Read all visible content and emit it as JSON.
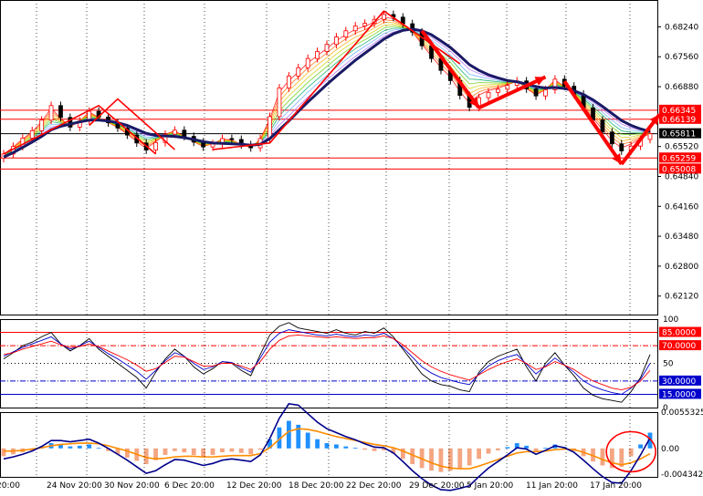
{
  "chart_data": [
    {
      "type": "line",
      "panel": "price",
      "y_ticks": [
        "0.68240",
        "0.67560",
        "0.66880",
        "0.65520",
        "0.64840",
        "0.64160",
        "0.63480",
        "0.62800",
        "0.62120"
      ],
      "ylim": [
        0.617,
        0.6885
      ],
      "level_badges": [
        {
          "label": "0.66345",
          "value": 0.66345,
          "color": "#ff0000"
        },
        {
          "label": "0.66139",
          "value": 0.66139,
          "color": "#ff0000"
        },
        {
          "label": "0.65811",
          "value": 0.65811,
          "color": "#000000"
        },
        {
          "label": "0.65259",
          "value": 0.65259,
          "color": "#ff0000"
        },
        {
          "label": "0.65008",
          "value": 0.65008,
          "color": "#ff0000"
        }
      ],
      "close_series": [
        0.6535,
        0.6552,
        0.6571,
        0.6588,
        0.6612,
        0.6645,
        0.6618,
        0.6596,
        0.661,
        0.6632,
        0.6619,
        0.6606,
        0.6594,
        0.6578,
        0.656,
        0.6544,
        0.6561,
        0.658,
        0.6589,
        0.6575,
        0.6562,
        0.6551,
        0.6558,
        0.657,
        0.6568,
        0.6556,
        0.6549,
        0.657,
        0.662,
        0.6685,
        0.6712,
        0.6731,
        0.6752,
        0.6768,
        0.6784,
        0.6801,
        0.6815,
        0.6826,
        0.6832,
        0.6841,
        0.6852,
        0.6846,
        0.6831,
        0.6812,
        0.6781,
        0.6752,
        0.6725,
        0.6702,
        0.6668,
        0.6641,
        0.6663,
        0.6675,
        0.6682,
        0.6691,
        0.6701,
        0.6683,
        0.6667,
        0.6681,
        0.6705,
        0.6689,
        0.6671,
        0.664,
        0.6612,
        0.6585,
        0.6558,
        0.6542,
        0.6553,
        0.6568,
        0.6581
      ],
      "moving_average": [
        0.6528,
        0.6538,
        0.655,
        0.6562,
        0.6575,
        0.659,
        0.6598,
        0.6603,
        0.6608,
        0.6612,
        0.6612,
        0.661,
        0.6606,
        0.66,
        0.6591,
        0.6582,
        0.6577,
        0.6576,
        0.6575,
        0.6572,
        0.6568,
        0.6563,
        0.656,
        0.6559,
        0.6558,
        0.6557,
        0.6555,
        0.6557,
        0.657,
        0.659,
        0.661,
        0.6632,
        0.6653,
        0.6673,
        0.6693,
        0.6712,
        0.673,
        0.6748,
        0.6764,
        0.678,
        0.6796,
        0.6808,
        0.6816,
        0.6819,
        0.6815,
        0.6806,
        0.6792,
        0.6777,
        0.6758,
        0.6738,
        0.6725,
        0.6715,
        0.6708,
        0.6702,
        0.6699,
        0.6694,
        0.6688,
        0.6685,
        0.6686,
        0.6684,
        0.6679,
        0.667,
        0.6658,
        0.6643,
        0.6627,
        0.6611,
        0.66,
        0.6592,
        0.6586
      ]
    },
    {
      "type": "line",
      "panel": "oscillator",
      "y_ticks": [
        "100",
        "50",
        "0"
      ],
      "ylim": [
        0,
        100
      ],
      "level_badges": [
        {
          "label": "85.0000",
          "value": 85,
          "color": "#ff0000"
        },
        {
          "label": "70.0000",
          "value": 70,
          "color": "#ff0000"
        },
        {
          "label": "30.0000",
          "value": 30,
          "color": "#0000cc"
        },
        {
          "label": "15.0000",
          "value": 15,
          "color": "#0000cc"
        }
      ],
      "series": [
        {
          "color": "#000000",
          "values": [
            55,
            62,
            70,
            74,
            80,
            85,
            72,
            64,
            70,
            78,
            66,
            58,
            50,
            42,
            34,
            22,
            40,
            55,
            66,
            58,
            46,
            38,
            44,
            52,
            50,
            42,
            36,
            60,
            82,
            92,
            96,
            90,
            88,
            86,
            84,
            88,
            84,
            82,
            86,
            84,
            90,
            80,
            66,
            52,
            38,
            30,
            26,
            24,
            20,
            18,
            40,
            52,
            58,
            62,
            66,
            46,
            30,
            50,
            62,
            48,
            36,
            22,
            14,
            10,
            8,
            6,
            18,
            34,
            60
          ]
        },
        {
          "color": "#0000cc",
          "values": [
            58,
            63,
            68,
            72,
            76,
            80,
            72,
            66,
            70,
            75,
            68,
            61,
            55,
            48,
            41,
            32,
            42,
            53,
            62,
            58,
            50,
            43,
            46,
            52,
            51,
            45,
            40,
            56,
            74,
            84,
            88,
            86,
            84,
            82,
            81,
            83,
            81,
            80,
            82,
            81,
            84,
            78,
            68,
            57,
            46,
            39,
            34,
            31,
            28,
            26,
            38,
            47,
            53,
            57,
            60,
            49,
            38,
            47,
            56,
            48,
            40,
            30,
            24,
            20,
            17,
            15,
            22,
            32,
            50
          ]
        },
        {
          "color": "#ff0000",
          "values": [
            60,
            62,
            66,
            69,
            72,
            75,
            71,
            68,
            69,
            72,
            69,
            64,
            59,
            54,
            48,
            41,
            44,
            51,
            58,
            57,
            52,
            47,
            47,
            50,
            50,
            47,
            43,
            52,
            66,
            76,
            81,
            82,
            81,
            80,
            79,
            80,
            79,
            78,
            79,
            79,
            81,
            78,
            71,
            62,
            53,
            46,
            41,
            37,
            34,
            31,
            37,
            43,
            48,
            52,
            55,
            50,
            43,
            46,
            52,
            48,
            43,
            36,
            30,
            26,
            22,
            20,
            23,
            30,
            42
          ]
        }
      ]
    },
    {
      "type": "bar",
      "panel": "macd",
      "y_ticks": [
        "0.0055325",
        "0.00",
        "-0.0043426"
      ],
      "ylim": [
        -0.0043426,
        0.0055325
      ],
      "histogram": [
        -0.0012,
        -0.0009,
        -0.0006,
        -0.0003,
        0.0002,
        0.0008,
        0.0006,
        0.0003,
        0.0004,
        0.0006,
        0.0001,
        -0.0004,
        -0.0009,
        -0.0014,
        -0.0019,
        -0.0024,
        -0.0018,
        -0.001,
        -0.0004,
        -0.0006,
        -0.001,
        -0.0013,
        -0.001,
        -0.0006,
        -0.0005,
        -0.0007,
        -0.0009,
        -0.0002,
        0.0014,
        0.0032,
        0.0042,
        0.0036,
        0.0024,
        0.0014,
        0.0008,
        0.0006,
        0.0003,
        0.0001,
        -0.0002,
        -0.0004,
        -0.0003,
        -0.0008,
        -0.0016,
        -0.0024,
        -0.003,
        -0.0034,
        -0.0036,
        -0.0034,
        -0.003,
        -0.0026,
        -0.0016,
        -0.0008,
        -0.0003,
        0.0002,
        0.0008,
        0.0004,
        -0.0004,
        0.0001,
        0.0006,
        0.0002,
        -0.0004,
        -0.0012,
        -0.002,
        -0.0026,
        -0.003,
        -0.0028,
        -0.0012,
        0.0006,
        0.0024
      ],
      "signal_line": [
        -0.0004,
        -0.0004,
        -0.0003,
        -0.0001,
        0.0001,
        0.0004,
        0.0006,
        0.0007,
        0.0008,
        0.0008,
        0.0007,
        0.0004,
        0.0,
        -0.0004,
        -0.0009,
        -0.0014,
        -0.0016,
        -0.0015,
        -0.0013,
        -0.0012,
        -0.0012,
        -0.0013,
        -0.0013,
        -0.0012,
        -0.0011,
        -0.0011,
        -0.0011,
        -0.0008,
        0.0001,
        0.0014,
        0.0026,
        0.003,
        0.0029,
        0.0026,
        0.0022,
        0.0018,
        0.0015,
        0.0012,
        0.0009,
        0.0006,
        0.0004,
        0.0001,
        -0.0004,
        -0.001,
        -0.0016,
        -0.0022,
        -0.0027,
        -0.003,
        -0.0031,
        -0.0031,
        -0.0027,
        -0.0022,
        -0.0017,
        -0.0012,
        -0.0007,
        -0.0005,
        -0.0005,
        -0.0004,
        -0.0002,
        -0.0001,
        -0.0002,
        -0.0006,
        -0.0011,
        -0.0017,
        -0.0022,
        -0.0025,
        -0.0022,
        -0.0016,
        -0.0008
      ],
      "macd_line": [
        -0.0016,
        -0.0013,
        -0.0009,
        -0.0004,
        0.0003,
        0.0012,
        0.0012,
        0.001,
        0.0012,
        0.0014,
        0.0008,
        0.0,
        -0.0009,
        -0.0018,
        -0.0028,
        -0.0038,
        -0.0034,
        -0.0025,
        -0.0017,
        -0.0018,
        -0.0022,
        -0.0026,
        -0.0023,
        -0.0018,
        -0.0016,
        -0.0018,
        -0.002,
        -0.001,
        0.0015,
        0.0046,
        0.0068,
        0.0066,
        0.0053,
        0.004,
        0.003,
        0.0024,
        0.0018,
        0.0013,
        0.0007,
        0.0002,
        0.0001,
        -0.0007,
        -0.002,
        -0.0034,
        -0.0046,
        -0.0056,
        -0.0063,
        -0.0064,
        -0.0061,
        -0.0057,
        -0.0043,
        -0.003,
        -0.002,
        -0.001,
        0.0001,
        -0.0001,
        -0.0009,
        -0.0003,
        0.0004,
        0.0001,
        -0.0006,
        -0.0018,
        -0.0031,
        -0.0043,
        -0.0052,
        -0.0053,
        -0.0034,
        -0.001,
        0.0016
      ]
    }
  ],
  "time_axis": {
    "labels": [
      "20:00",
      "24 Nov 20:00",
      "30 Nov 20:00",
      "6 Dec 20:00",
      "12 Dec 20:00",
      "18 Dec 20:00",
      "22 Dec 20:00",
      "29 Dec 20:00",
      "5 Jan 20:00",
      "11 Jan 20:00",
      "17 Jan 20:00"
    ]
  },
  "colors": {
    "bull": "#ff0000",
    "bear": "#000000",
    "histogram_positive": "#1e90ff",
    "histogram_negative": "#f4a582",
    "signal_line": "#ff8c00",
    "macd_line": "#00008b",
    "moving_average": "#1a1a66"
  }
}
